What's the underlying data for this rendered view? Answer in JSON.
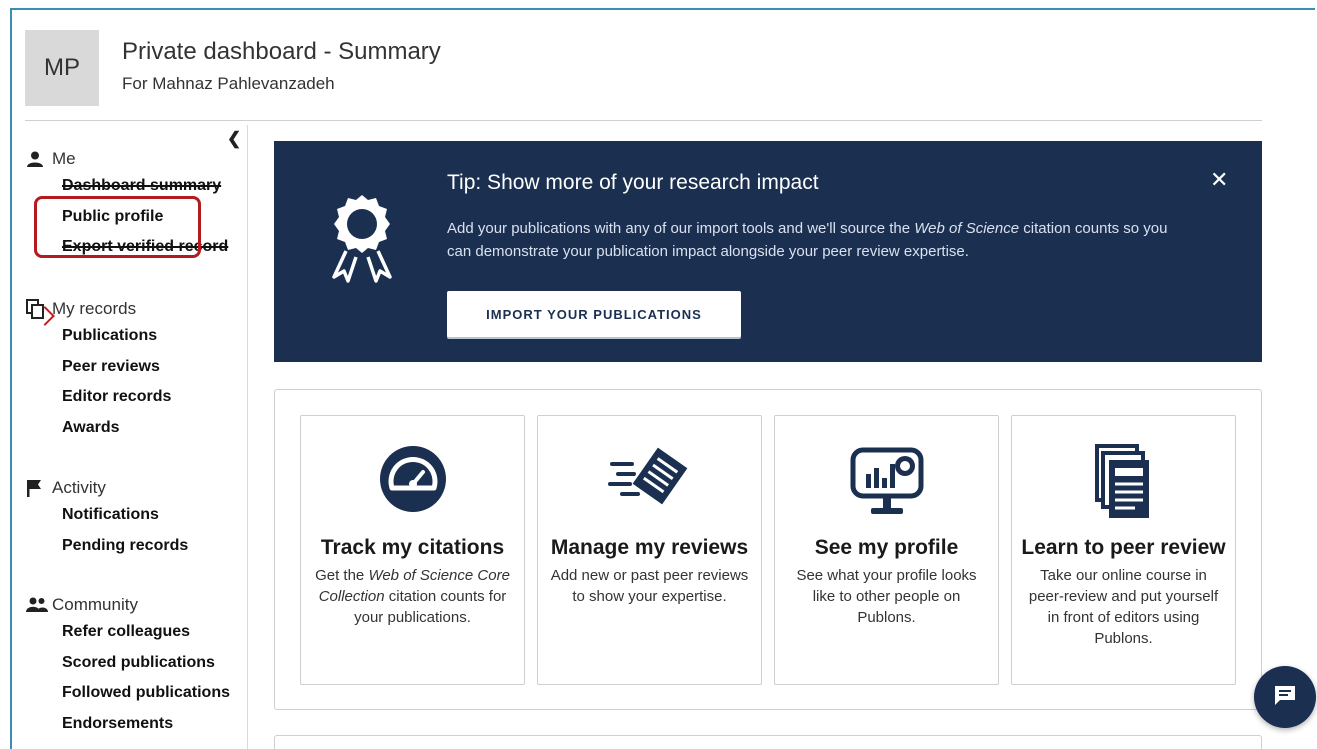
{
  "header": {
    "avatar_initials": "MP",
    "title": "Private dashboard - Summary",
    "subtitle": "For Mahnaz Pahlevanzadeh"
  },
  "sidebar": {
    "collapse_icon": "chevron-left-icon",
    "groups": [
      {
        "label": "Me",
        "icon": "person-icon",
        "items": [
          {
            "label": "Dashboard summary"
          },
          {
            "label": "Public profile"
          },
          {
            "label": "Export verified record"
          }
        ]
      },
      {
        "label": "My records",
        "icon": "copy-icon",
        "items": [
          {
            "label": "Publications"
          },
          {
            "label": "Peer reviews"
          },
          {
            "label": "Editor records"
          },
          {
            "label": "Awards"
          }
        ]
      },
      {
        "label": "Activity",
        "icon": "flag-icon",
        "items": [
          {
            "label": "Notifications"
          },
          {
            "label": "Pending records"
          }
        ]
      },
      {
        "label": "Community",
        "icon": "people-icon",
        "items": [
          {
            "label": "Refer colleagues"
          },
          {
            "label": "Scored publications"
          },
          {
            "label": "Followed publications"
          },
          {
            "label": "Endorsements"
          }
        ]
      }
    ]
  },
  "tip": {
    "title": "Tip: Show more of your research impact",
    "body_before": "Add your publications with any of our import tools and we'll source the ",
    "body_em": "Web of Science",
    "body_after": " citation counts so you can demonstrate your publication impact alongside your peer review expertise.",
    "button_label": "IMPORT YOUR PUBLICATIONS",
    "close_label": "✕",
    "icon": "award-ribbon-icon"
  },
  "cards": [
    {
      "title": "Track my citations",
      "icon": "gauge-icon",
      "desc_before": "Get the ",
      "desc_em": "Web of Science Core Collection",
      "desc_after": " citation counts for your publications."
    },
    {
      "title": "Manage my reviews",
      "icon": "document-speed-icon",
      "desc_before": "Add new or past peer reviews to show your expertise.",
      "desc_em": "",
      "desc_after": ""
    },
    {
      "title": "See my profile",
      "icon": "monitor-chart-icon",
      "desc_before": "See what your profile looks like to other people on Publons.",
      "desc_em": "",
      "desc_after": ""
    },
    {
      "title": "Learn to peer review",
      "icon": "documents-stack-icon",
      "desc_before": "Take our online course in peer-review and put yourself in front of editors using Publons.",
      "desc_em": "",
      "desc_after": ""
    }
  ],
  "colors": {
    "navy": "#1b2f51",
    "highlight_red": "#b31b1f",
    "frame_blue": "#3a8fb0"
  },
  "chat": {
    "icon": "chat-icon"
  }
}
